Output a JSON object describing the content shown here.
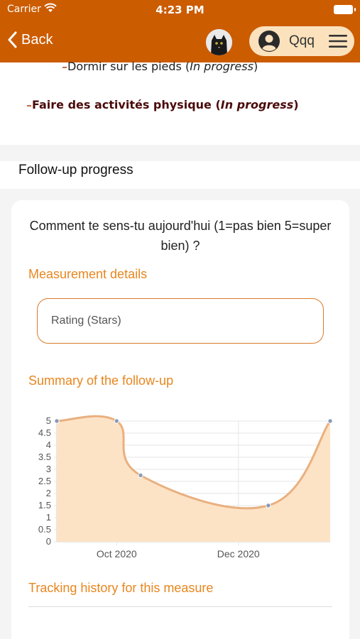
{
  "status_bar": {
    "carrier": "Carrier",
    "time": "4:23 PM"
  },
  "nav": {
    "back_label": "Back",
    "user_name": "Qqq"
  },
  "goals": {
    "goal1_text": "Dormir sur les pieds (",
    "goal1_status": "In progress",
    "goal1_close": ")",
    "goal2_text": "Faire des activités physique (",
    "goal2_status": "In progress",
    "goal2_close": ")"
  },
  "followup": {
    "title": "Follow-up progress",
    "question": "Comment te sens-tu aujourd'hui (1=pas bien 5=super bien) ?",
    "measurement_title": "Measurement details",
    "measurement_value": "Rating (Stars)",
    "summary_title": "Summary of the follow-up",
    "history_title": "Tracking history for this measure"
  },
  "colors": {
    "accent": "#cc5c00",
    "section_title": "#e8861e",
    "pill_bg": "#fbe2bd",
    "area_fill": "#fde3c6",
    "line": "#e9b07f"
  },
  "chart_data": {
    "type": "area",
    "yticks": [
      "5",
      "4.5",
      "4",
      "3.5",
      "3",
      "2.5",
      "2",
      "1.5",
      "1",
      "0.5",
      "0"
    ],
    "xticks": [
      "Oct 2020",
      "Dec 2020"
    ],
    "ylim": [
      0,
      5
    ],
    "grid": true,
    "points": [
      {
        "x": "2020-09-01",
        "y": 5
      },
      {
        "x": "2020-10-01",
        "y": 5
      },
      {
        "x": "2020-10-13",
        "y": 2.75
      },
      {
        "x": "2020-12-16",
        "y": 1.5
      },
      {
        "x": "2021-01-16",
        "y": 5
      }
    ]
  }
}
